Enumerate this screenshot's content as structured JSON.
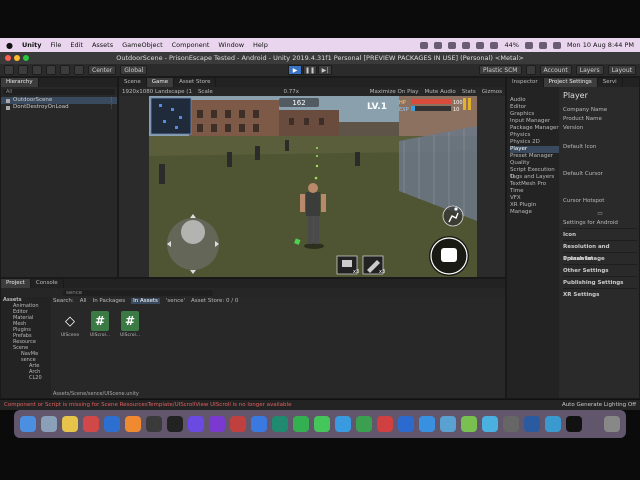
{
  "menubar": {
    "app": "Unity",
    "items": [
      "File",
      "Edit",
      "Assets",
      "GameObject",
      "Component",
      "Window",
      "Help"
    ],
    "battery": "44%",
    "datetime": "Mon 10 Aug  8:44 PM"
  },
  "window": {
    "title": "OutdoorScene - PrisonEscape Tested - Android - Unity 2019.4.31f1 Personal [PREVIEW PACKAGES IN USE] (Personal) <Metal>"
  },
  "toolbar": {
    "pivot": "Center",
    "space": "Global",
    "plastic": "Plastic SCM",
    "account": "Account",
    "layers": "Layers",
    "layout": "Layout"
  },
  "hierarchy": {
    "tab": "Hierarchy",
    "search_placeholder": "All",
    "items": [
      "OutdoorScene",
      "DontDestroyOnLoad"
    ]
  },
  "gameview": {
    "tabs": [
      "Scene",
      "Game",
      "Asset Store"
    ],
    "resolution": "1920x1080 Landscape (1",
    "scale_label": "Scale",
    "scale_value": "0.77x",
    "options": [
      "Maximize On Play",
      "Mute Audio",
      "Stats",
      "Gizmos"
    ],
    "hud": {
      "score": "162",
      "level": "LV.1",
      "hp_label": "HP",
      "hp_value": "100",
      "hp_fraction": 1.0,
      "exp_label": "EXP",
      "exp_value": "10",
      "exp_fraction": 0.1,
      "item1_count": "x3",
      "item2_count": "x3"
    }
  },
  "inspector": {
    "tabs": [
      "Inspector",
      "Project Settings",
      "Servi"
    ],
    "categories": [
      "Audio",
      "Editor",
      "Graphics",
      "Input Manager",
      "Package Manager",
      "Physics",
      "Physics 2D",
      "Player",
      "Preset Manager",
      "Quality",
      "Script Execution O",
      "Tags and Layers",
      "TextMesh Pro",
      "Time",
      "VFX",
      "XR Plugin Manage"
    ],
    "selected": "Player",
    "title": "Player",
    "fields": [
      "Company Name",
      "Product Name",
      "Version"
    ],
    "default_icon": "Default Icon",
    "default_cursor": "Default Cursor",
    "cursor_hotspot": "Cursor Hotspot",
    "platform_label": "Settings for Android",
    "sections": [
      "Icon",
      "Resolution and Presentat",
      "Splash Image",
      "Other Settings",
      "Publishing Settings",
      "XR Settings"
    ]
  },
  "project": {
    "tabs": [
      "Project",
      "Console"
    ],
    "tree": [
      "Assets",
      "Animation",
      "Editor",
      "Material",
      "Mesh",
      "Plugins",
      "Prefabs",
      "Resource",
      "Scene",
      "NavMe",
      "sence",
      "Arte",
      "Arch",
      "CL20"
    ],
    "search_text": "sence",
    "search_label": "Search:",
    "search_scopes": [
      "All",
      "In Packages",
      "In Assets",
      "'sence'"
    ],
    "asset_store": "Asset Store: 0 / 0",
    "assets": [
      {
        "name": "UIScene",
        "type": "unity"
      },
      {
        "name": "UIScrol...",
        "type": "cs"
      },
      {
        "name": "UIScrol...",
        "type": "cs"
      }
    ],
    "path": "Assets/Scene/sence/UIScene.unity"
  },
  "statusbar": {
    "error": "Component or Script is missing for Scene ResourcesTemplate/UIScrollView UIScroll is no longer available",
    "right": "Auto Generate Lighting Off"
  }
}
